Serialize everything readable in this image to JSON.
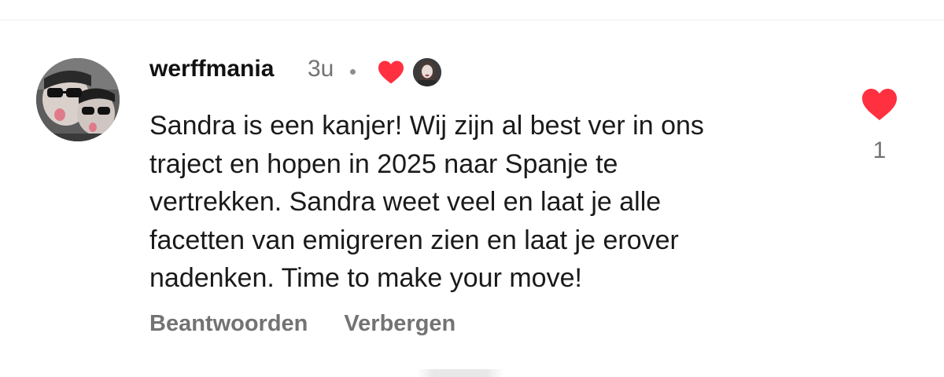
{
  "comment": {
    "username": "werffmania",
    "timestamp": "3u",
    "separator": "•",
    "creator_liked": true,
    "text": "Sandra is een kanjer! Wij zijn al best ver in ons\ntraject en hopen in 2025 naar Spanje te\nvertrekken. Sandra weet veel en laat je alle\nfacetten van emigreren zien en laat je erover\nnadenken. Time to make your move!",
    "like_count": "1",
    "actions": {
      "reply_label": "Beantwoorden",
      "hide_label": "Verbergen"
    }
  },
  "icons": {
    "creator_heart": "heart-filled-icon",
    "like_heart": "heart-filled-icon"
  },
  "colors": {
    "heart_red": "#ff3040",
    "muted_text": "#737373",
    "primary_text": "#111111"
  }
}
